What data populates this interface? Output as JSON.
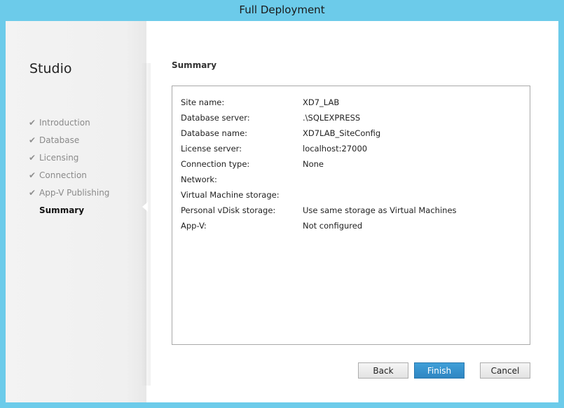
{
  "window": {
    "title": "Full Deployment"
  },
  "sidebar": {
    "heading": "Studio",
    "steps": [
      {
        "label": "Introduction",
        "completed": true
      },
      {
        "label": "Database",
        "completed": true
      },
      {
        "label": "Licensing",
        "completed": true
      },
      {
        "label": "Connection",
        "completed": true
      },
      {
        "label": "App-V Publishing",
        "completed": true
      },
      {
        "label": "Summary",
        "completed": false,
        "current": true
      }
    ],
    "check_glyph": "✔"
  },
  "main": {
    "title": "Summary",
    "rows": [
      {
        "label": "Site name:",
        "value": "XD7_LAB"
      },
      {
        "label": "Database server:",
        "value": ".\\SQLEXPRESS"
      },
      {
        "label": "Database name:",
        "value": "XD7LAB_SiteConfig"
      },
      {
        "label": "License server:",
        "value": "localhost:27000"
      },
      {
        "label": "Connection type:",
        "value": "None"
      },
      {
        "label": "Network:",
        "value": ""
      },
      {
        "label": "Virtual Machine storage:",
        "value": ""
      },
      {
        "label": "Personal vDisk storage:",
        "value": "Use same storage as Virtual Machines"
      },
      {
        "label": "App-V:",
        "value": "Not configured"
      }
    ]
  },
  "buttons": {
    "back": "Back",
    "finish": "Finish",
    "cancel": "Cancel"
  },
  "colors": {
    "frame": "#6ccbea",
    "primary_button": "#2f86c2"
  }
}
